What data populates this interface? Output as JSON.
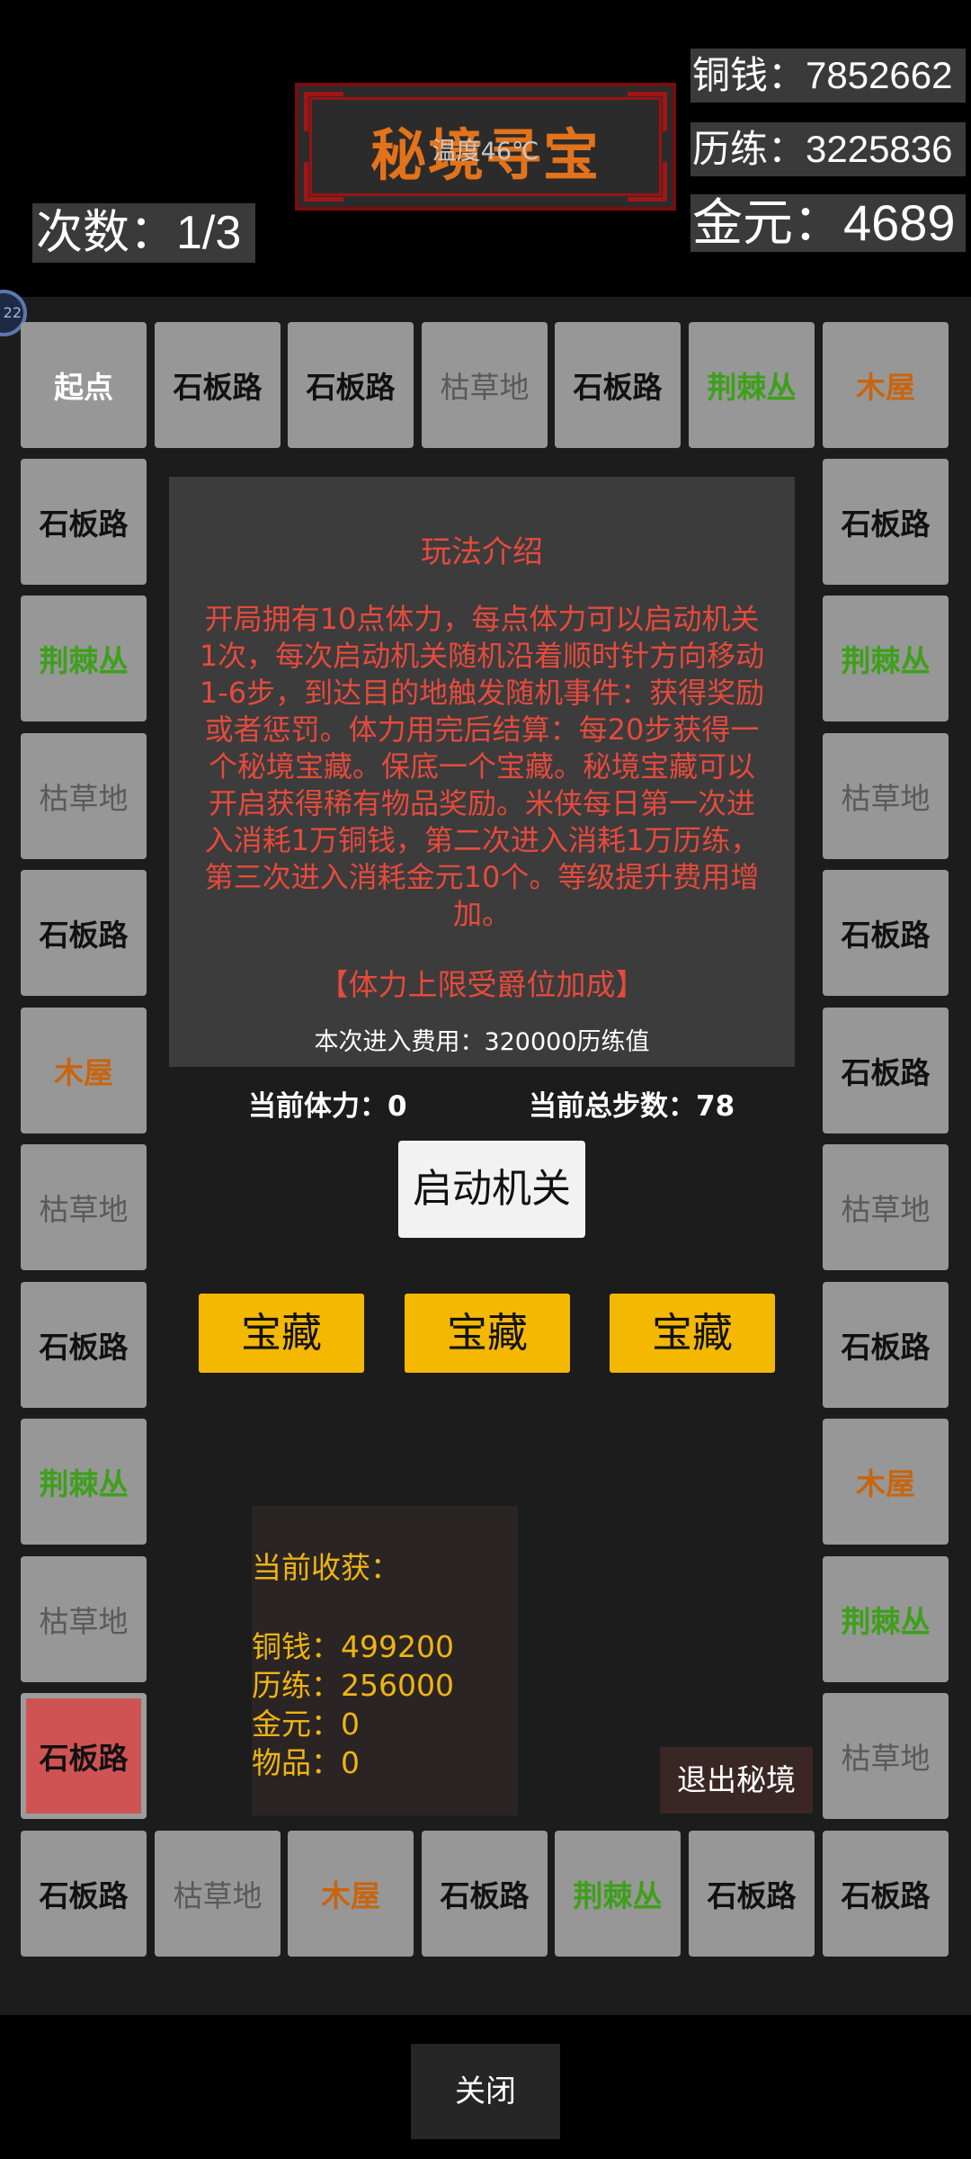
{
  "header": {
    "title": "秘境寻宝",
    "temperature": "温度46℃",
    "coins": "铜钱：7852662",
    "experience": "历练：3225836",
    "gold": "金元：4689",
    "tries": "次数：1/3"
  },
  "avatar_badge": "22",
  "board": {
    "top_row": [
      "起点",
      "石板路",
      "石板路",
      "枯草地",
      "石板路",
      "荆棘丛",
      "木屋"
    ],
    "right_column": [
      "石板路",
      "荆棘丛",
      "枯草地",
      "石板路",
      "石板路",
      "枯草地",
      "石板路",
      "木屋",
      "荆棘丛",
      "枯草地"
    ],
    "bottom_row": [
      "石板路",
      "枯草地",
      "木屋",
      "石板路",
      "荆棘丛",
      "石板路",
      "石板路"
    ],
    "left_column": [
      "石板路",
      "荆棘丛",
      "枯草地",
      "石板路",
      "木屋",
      "枯草地",
      "石板路",
      "荆棘丛",
      "枯草地",
      "石板路"
    ],
    "current_tile_label": "石板路"
  },
  "rules": {
    "title": "玩法介绍",
    "body": "开局拥有10点体力，每点体力可以启动机关1次，每次启动机关随机沿着顺时针方向移动1-6步，到达目的地触发随机事件：获得奖励或者惩罚。体力用完后结算：每20步获得一个秘境宝藏。保底一个宝藏。秘境宝藏可以开启获得稀有物品奖励。米侠每日第一次进入消耗1万铜钱，第二次进入消耗1万历练，第三次进入消耗金元10个。等级提升费用增加。",
    "note": "【体力上限受爵位加成】",
    "cost": "本次进入费用：320000历练值"
  },
  "status": {
    "stamina": "当前体力：0",
    "total_steps": "当前总步数：78"
  },
  "actions": {
    "launch": "启动机关",
    "treasures": [
      "宝藏",
      "宝藏",
      "宝藏"
    ],
    "exit": "退出秘境",
    "close": "关闭"
  },
  "harvest": {
    "title": "当前收获：",
    "coins": "铜钱：499200",
    "experience": "历练：256000",
    "gold": "金元：0",
    "items": "物品：0"
  },
  "colors": {
    "title_orange": "#e2731b",
    "rules_red": "#e64a3c",
    "treasure_yellow": "#f4b800",
    "thorn_green": "#3ea01a",
    "house_orange": "#c8650e",
    "current_tile": "#cf5353"
  }
}
